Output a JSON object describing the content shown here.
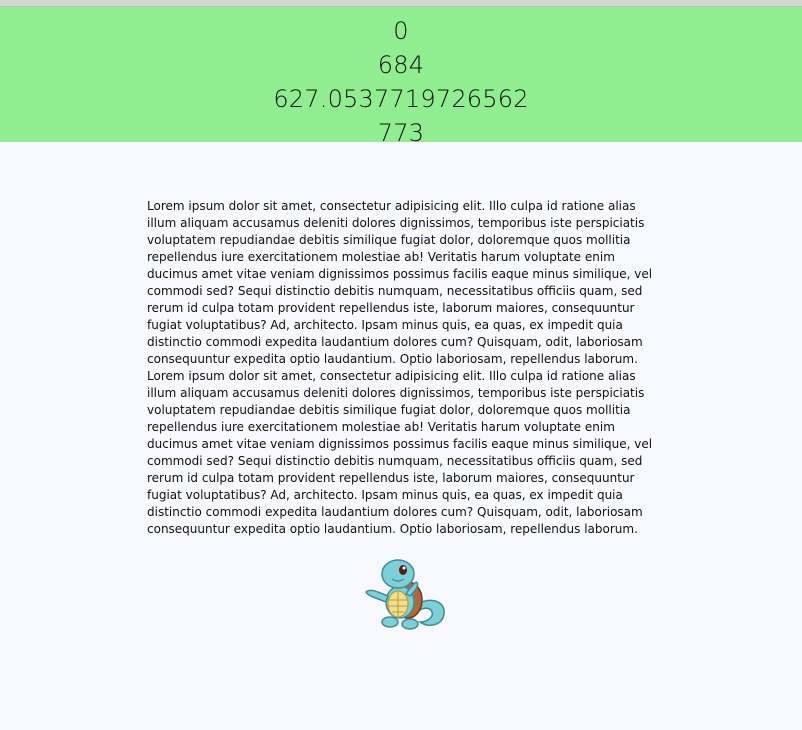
{
  "readout": {
    "line1": "0",
    "line2": "684",
    "line3": "627.0537719726562",
    "line4": "773"
  },
  "content": {
    "paragraph": "Lorem ipsum dolor sit amet, consectetur adipisicing elit. Illo culpa id ratione alias illum aliquam accusamus deleniti dolores dignissimos, temporibus iste perspiciatis voluptatem repudiandae debitis similique fugiat dolor, doloremque quos mollitia repellendus iure exercitationem molestiae ab! Veritatis harum voluptate enim ducimus amet vitae veniam dignissimos possimus facilis eaque minus similique, vel commodi sed? Sequi distinctio debitis numquam, necessitatibus officiis quam, sed rerum id culpa totam provident repellendus iste, laborum maiores, consequuntur fugiat voluptatibus? Ad, architecto. Ipsam minus quis, ea quas, ex impedit quia distinctio commodi expedita laudantium dolores cum? Quisquam, odit, laboriosam consequuntur expedita optio laudantium. Optio laboriosam, repellendus laborum. Lorem ipsum dolor sit amet, consectetur adipisicing elit. Illo culpa id ratione alias illum aliquam accusamus deleniti dolores dignissimos, temporibus iste perspiciatis voluptatem repudiandae debitis similique fugiat dolor, doloremque quos mollitia repellendus iure exercitationem molestiae ab! Veritatis harum voluptate enim ducimus amet vitae veniam dignissimos possimus facilis eaque minus similique, vel commodi sed? Sequi distinctio debitis numquam, necessitatibus officiis quam, sed rerum id culpa totam provident repellendus iste, laborum maiores, consequuntur fugiat voluptatibus? Ad, architecto. Ipsam minus quis, ea quas, ex impedit quia distinctio commodi expedita laudantium dolores cum? Quisquam, odit, laboriosam consequuntur expedita optio laudantium. Optio laboriosam, repellendus laborum."
  },
  "image": {
    "icon": "squirtle-illustration"
  },
  "colors": {
    "readout_bg": "#90ee90",
    "page_bg": "#f8f8ff"
  }
}
